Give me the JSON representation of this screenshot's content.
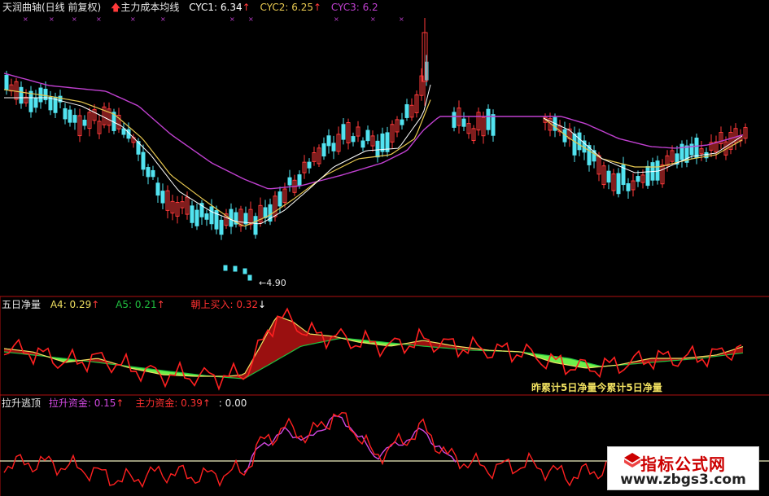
{
  "colors": {
    "up": "#ff3a3a",
    "down": "#52e3f0",
    "cyc1": "#ffffff",
    "cyc2": "#e8c850",
    "cyc3": "#c040d0",
    "fill_green": "#6ef04a",
    "fill_red": "#9a1010",
    "panel_border": "#b01010",
    "line_red": "#ff2020",
    "line_yellow": "#f0e060",
    "line_green": "#20c040",
    "line_magenta": "#d048e0",
    "line_white_h": "#f0f0c0"
  },
  "panel1": {
    "title": "天润曲轴(日线 前复权)",
    "indicator": "主力成本均线",
    "cyc1_label": "CYC1: 6.34",
    "cyc2_label": "CYC2: 6.25",
    "cyc3_label": "CYC3: 6.2",
    "low_price_label": "4.90"
  },
  "panel2": {
    "title": "五日净量",
    "a4_label": "A4: 0.29",
    "a5_label": "A5: 0.21",
    "buy_label": "朝上买入: 0.32",
    "annotation": "昨累计5日净量今累计5日净量"
  },
  "panel3": {
    "title": "拉升逃顶",
    "pull_label": "拉升资金: 0.15",
    "main_label": "主力资金: 0.39",
    "zero_label": ": 0.00"
  },
  "watermark": {
    "line1": "指标公式网",
    "line2": "www.zbgs3.com"
  }
}
